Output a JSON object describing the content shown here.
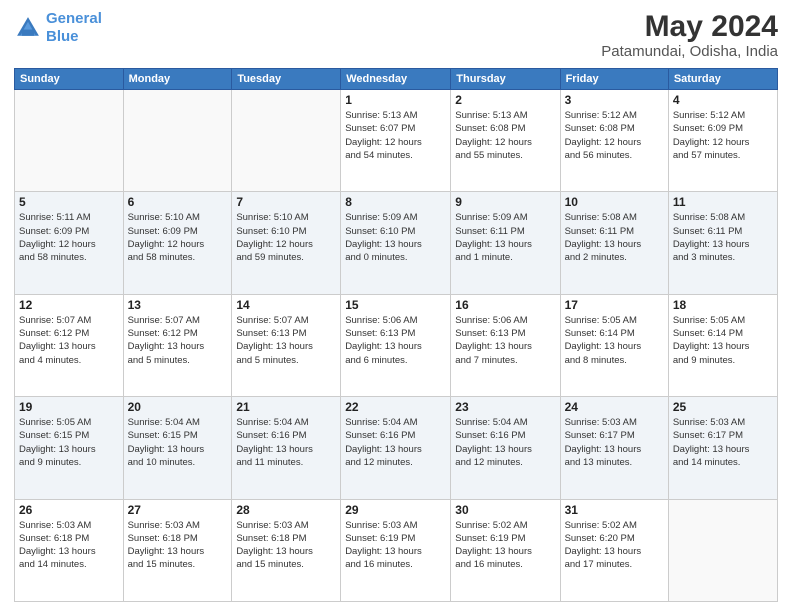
{
  "header": {
    "logo_line1": "General",
    "logo_line2": "Blue",
    "title": "May 2024",
    "subtitle": "Patamundai, Odisha, India"
  },
  "weekdays": [
    "Sunday",
    "Monday",
    "Tuesday",
    "Wednesday",
    "Thursday",
    "Friday",
    "Saturday"
  ],
  "weeks": [
    [
      {
        "day": "",
        "info": ""
      },
      {
        "day": "",
        "info": ""
      },
      {
        "day": "",
        "info": ""
      },
      {
        "day": "1",
        "info": "Sunrise: 5:13 AM\nSunset: 6:07 PM\nDaylight: 12 hours\nand 54 minutes."
      },
      {
        "day": "2",
        "info": "Sunrise: 5:13 AM\nSunset: 6:08 PM\nDaylight: 12 hours\nand 55 minutes."
      },
      {
        "day": "3",
        "info": "Sunrise: 5:12 AM\nSunset: 6:08 PM\nDaylight: 12 hours\nand 56 minutes."
      },
      {
        "day": "4",
        "info": "Sunrise: 5:12 AM\nSunset: 6:09 PM\nDaylight: 12 hours\nand 57 minutes."
      }
    ],
    [
      {
        "day": "5",
        "info": "Sunrise: 5:11 AM\nSunset: 6:09 PM\nDaylight: 12 hours\nand 58 minutes."
      },
      {
        "day": "6",
        "info": "Sunrise: 5:10 AM\nSunset: 6:09 PM\nDaylight: 12 hours\nand 58 minutes."
      },
      {
        "day": "7",
        "info": "Sunrise: 5:10 AM\nSunset: 6:10 PM\nDaylight: 12 hours\nand 59 minutes."
      },
      {
        "day": "8",
        "info": "Sunrise: 5:09 AM\nSunset: 6:10 PM\nDaylight: 13 hours\nand 0 minutes."
      },
      {
        "day": "9",
        "info": "Sunrise: 5:09 AM\nSunset: 6:11 PM\nDaylight: 13 hours\nand 1 minute."
      },
      {
        "day": "10",
        "info": "Sunrise: 5:08 AM\nSunset: 6:11 PM\nDaylight: 13 hours\nand 2 minutes."
      },
      {
        "day": "11",
        "info": "Sunrise: 5:08 AM\nSunset: 6:11 PM\nDaylight: 13 hours\nand 3 minutes."
      }
    ],
    [
      {
        "day": "12",
        "info": "Sunrise: 5:07 AM\nSunset: 6:12 PM\nDaylight: 13 hours\nand 4 minutes."
      },
      {
        "day": "13",
        "info": "Sunrise: 5:07 AM\nSunset: 6:12 PM\nDaylight: 13 hours\nand 5 minutes."
      },
      {
        "day": "14",
        "info": "Sunrise: 5:07 AM\nSunset: 6:13 PM\nDaylight: 13 hours\nand 5 minutes."
      },
      {
        "day": "15",
        "info": "Sunrise: 5:06 AM\nSunset: 6:13 PM\nDaylight: 13 hours\nand 6 minutes."
      },
      {
        "day": "16",
        "info": "Sunrise: 5:06 AM\nSunset: 6:13 PM\nDaylight: 13 hours\nand 7 minutes."
      },
      {
        "day": "17",
        "info": "Sunrise: 5:05 AM\nSunset: 6:14 PM\nDaylight: 13 hours\nand 8 minutes."
      },
      {
        "day": "18",
        "info": "Sunrise: 5:05 AM\nSunset: 6:14 PM\nDaylight: 13 hours\nand 9 minutes."
      }
    ],
    [
      {
        "day": "19",
        "info": "Sunrise: 5:05 AM\nSunset: 6:15 PM\nDaylight: 13 hours\nand 9 minutes."
      },
      {
        "day": "20",
        "info": "Sunrise: 5:04 AM\nSunset: 6:15 PM\nDaylight: 13 hours\nand 10 minutes."
      },
      {
        "day": "21",
        "info": "Sunrise: 5:04 AM\nSunset: 6:16 PM\nDaylight: 13 hours\nand 11 minutes."
      },
      {
        "day": "22",
        "info": "Sunrise: 5:04 AM\nSunset: 6:16 PM\nDaylight: 13 hours\nand 12 minutes."
      },
      {
        "day": "23",
        "info": "Sunrise: 5:04 AM\nSunset: 6:16 PM\nDaylight: 13 hours\nand 12 minutes."
      },
      {
        "day": "24",
        "info": "Sunrise: 5:03 AM\nSunset: 6:17 PM\nDaylight: 13 hours\nand 13 minutes."
      },
      {
        "day": "25",
        "info": "Sunrise: 5:03 AM\nSunset: 6:17 PM\nDaylight: 13 hours\nand 14 minutes."
      }
    ],
    [
      {
        "day": "26",
        "info": "Sunrise: 5:03 AM\nSunset: 6:18 PM\nDaylight: 13 hours\nand 14 minutes."
      },
      {
        "day": "27",
        "info": "Sunrise: 5:03 AM\nSunset: 6:18 PM\nDaylight: 13 hours\nand 15 minutes."
      },
      {
        "day": "28",
        "info": "Sunrise: 5:03 AM\nSunset: 6:18 PM\nDaylight: 13 hours\nand 15 minutes."
      },
      {
        "day": "29",
        "info": "Sunrise: 5:03 AM\nSunset: 6:19 PM\nDaylight: 13 hours\nand 16 minutes."
      },
      {
        "day": "30",
        "info": "Sunrise: 5:02 AM\nSunset: 6:19 PM\nDaylight: 13 hours\nand 16 minutes."
      },
      {
        "day": "31",
        "info": "Sunrise: 5:02 AM\nSunset: 6:20 PM\nDaylight: 13 hours\nand 17 minutes."
      },
      {
        "day": "",
        "info": ""
      }
    ]
  ]
}
